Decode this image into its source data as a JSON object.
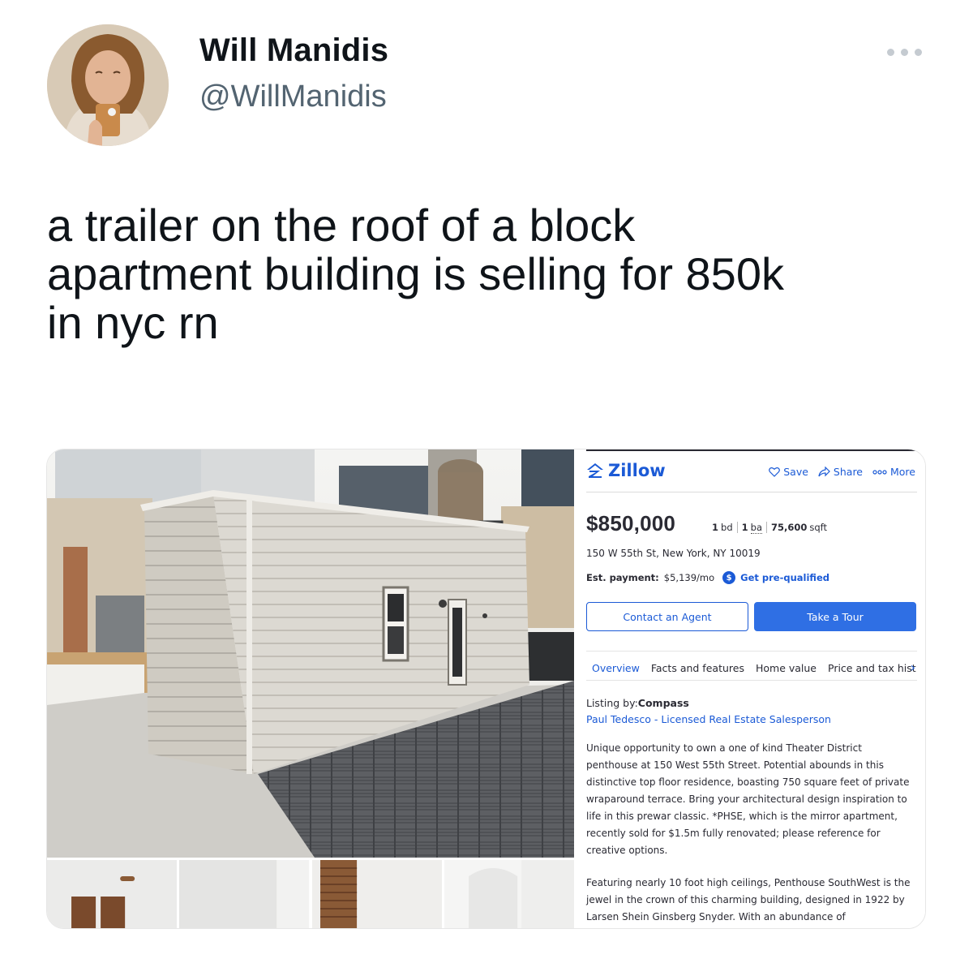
{
  "tweet": {
    "author_name": "Will Manidis",
    "author_handle": "@WillManidis",
    "text": "a trailer on the roof of a block\napartment building is selling for 850k\nin nyc rn"
  },
  "zillow": {
    "logo": "Zillow",
    "actions": {
      "save": "Save",
      "share": "Share",
      "more": "More"
    },
    "price": "$850,000",
    "beds_num": "1",
    "beds_label": "bd",
    "baths_num": "1",
    "baths_label": "ba",
    "sqft_num": "75,600",
    "sqft_label": "sqft",
    "address": "150 W 55th St, New York, NY 10019",
    "est_label": "Est. payment:",
    "est_value": "$5,139/mo",
    "dollar_badge": "$",
    "prequalify": "Get pre-qualified",
    "contact_button": "Contact an Agent",
    "tour_button": "Take a Tour",
    "tabs": [
      "Overview",
      "Facts and features",
      "Home value",
      "Price and tax hist"
    ],
    "chevron": "›",
    "listing_by_label": "Listing by:",
    "listing_by_company": "Compass",
    "agent": "Paul Tedesco - Licensed Real Estate Salesperson",
    "desc_p1": "Unique opportunity to own a one of kind Theater District penthouse at 150 West 55th Street. Potential abounds in this distinctive top floor residence, boasting 750 square feet of private wraparound terrace. Bring your architectural design inspiration to life in this prewar classic. *PHSE, which is the mirror apartment, recently sold for $1.5m fully renovated; please reference for creative options.",
    "desc_p2": "Featuring nearly 10 foot high ceilings, Penthouse SouthWest is the jewel in the crown of this charming building, designed in 1922 by Larsen Shein Ginsberg Snyder. With an abundance of",
    "colors": {
      "brand_blue": "#1b5ad6",
      "button_blue": "#2f6fe4",
      "text": "#2a2a33"
    }
  }
}
